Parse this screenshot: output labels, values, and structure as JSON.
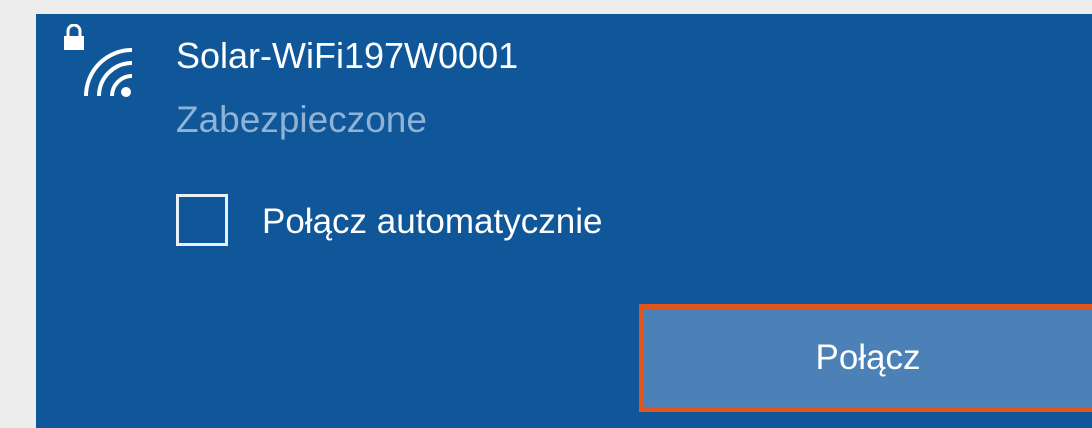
{
  "network": {
    "name": "Solar-WiFi197W0001",
    "security": "Zabezpieczone",
    "icon": "wifi-secured-icon"
  },
  "auto_connect": {
    "label": "Połącz automatycznie",
    "checked": false
  },
  "connect_button": {
    "label": "Połącz"
  },
  "colors": {
    "panel_background": "#0f5799",
    "button_background": "#4b81b6",
    "highlight_border": "#e2561d",
    "secondary_text": "#8fb3d6"
  }
}
